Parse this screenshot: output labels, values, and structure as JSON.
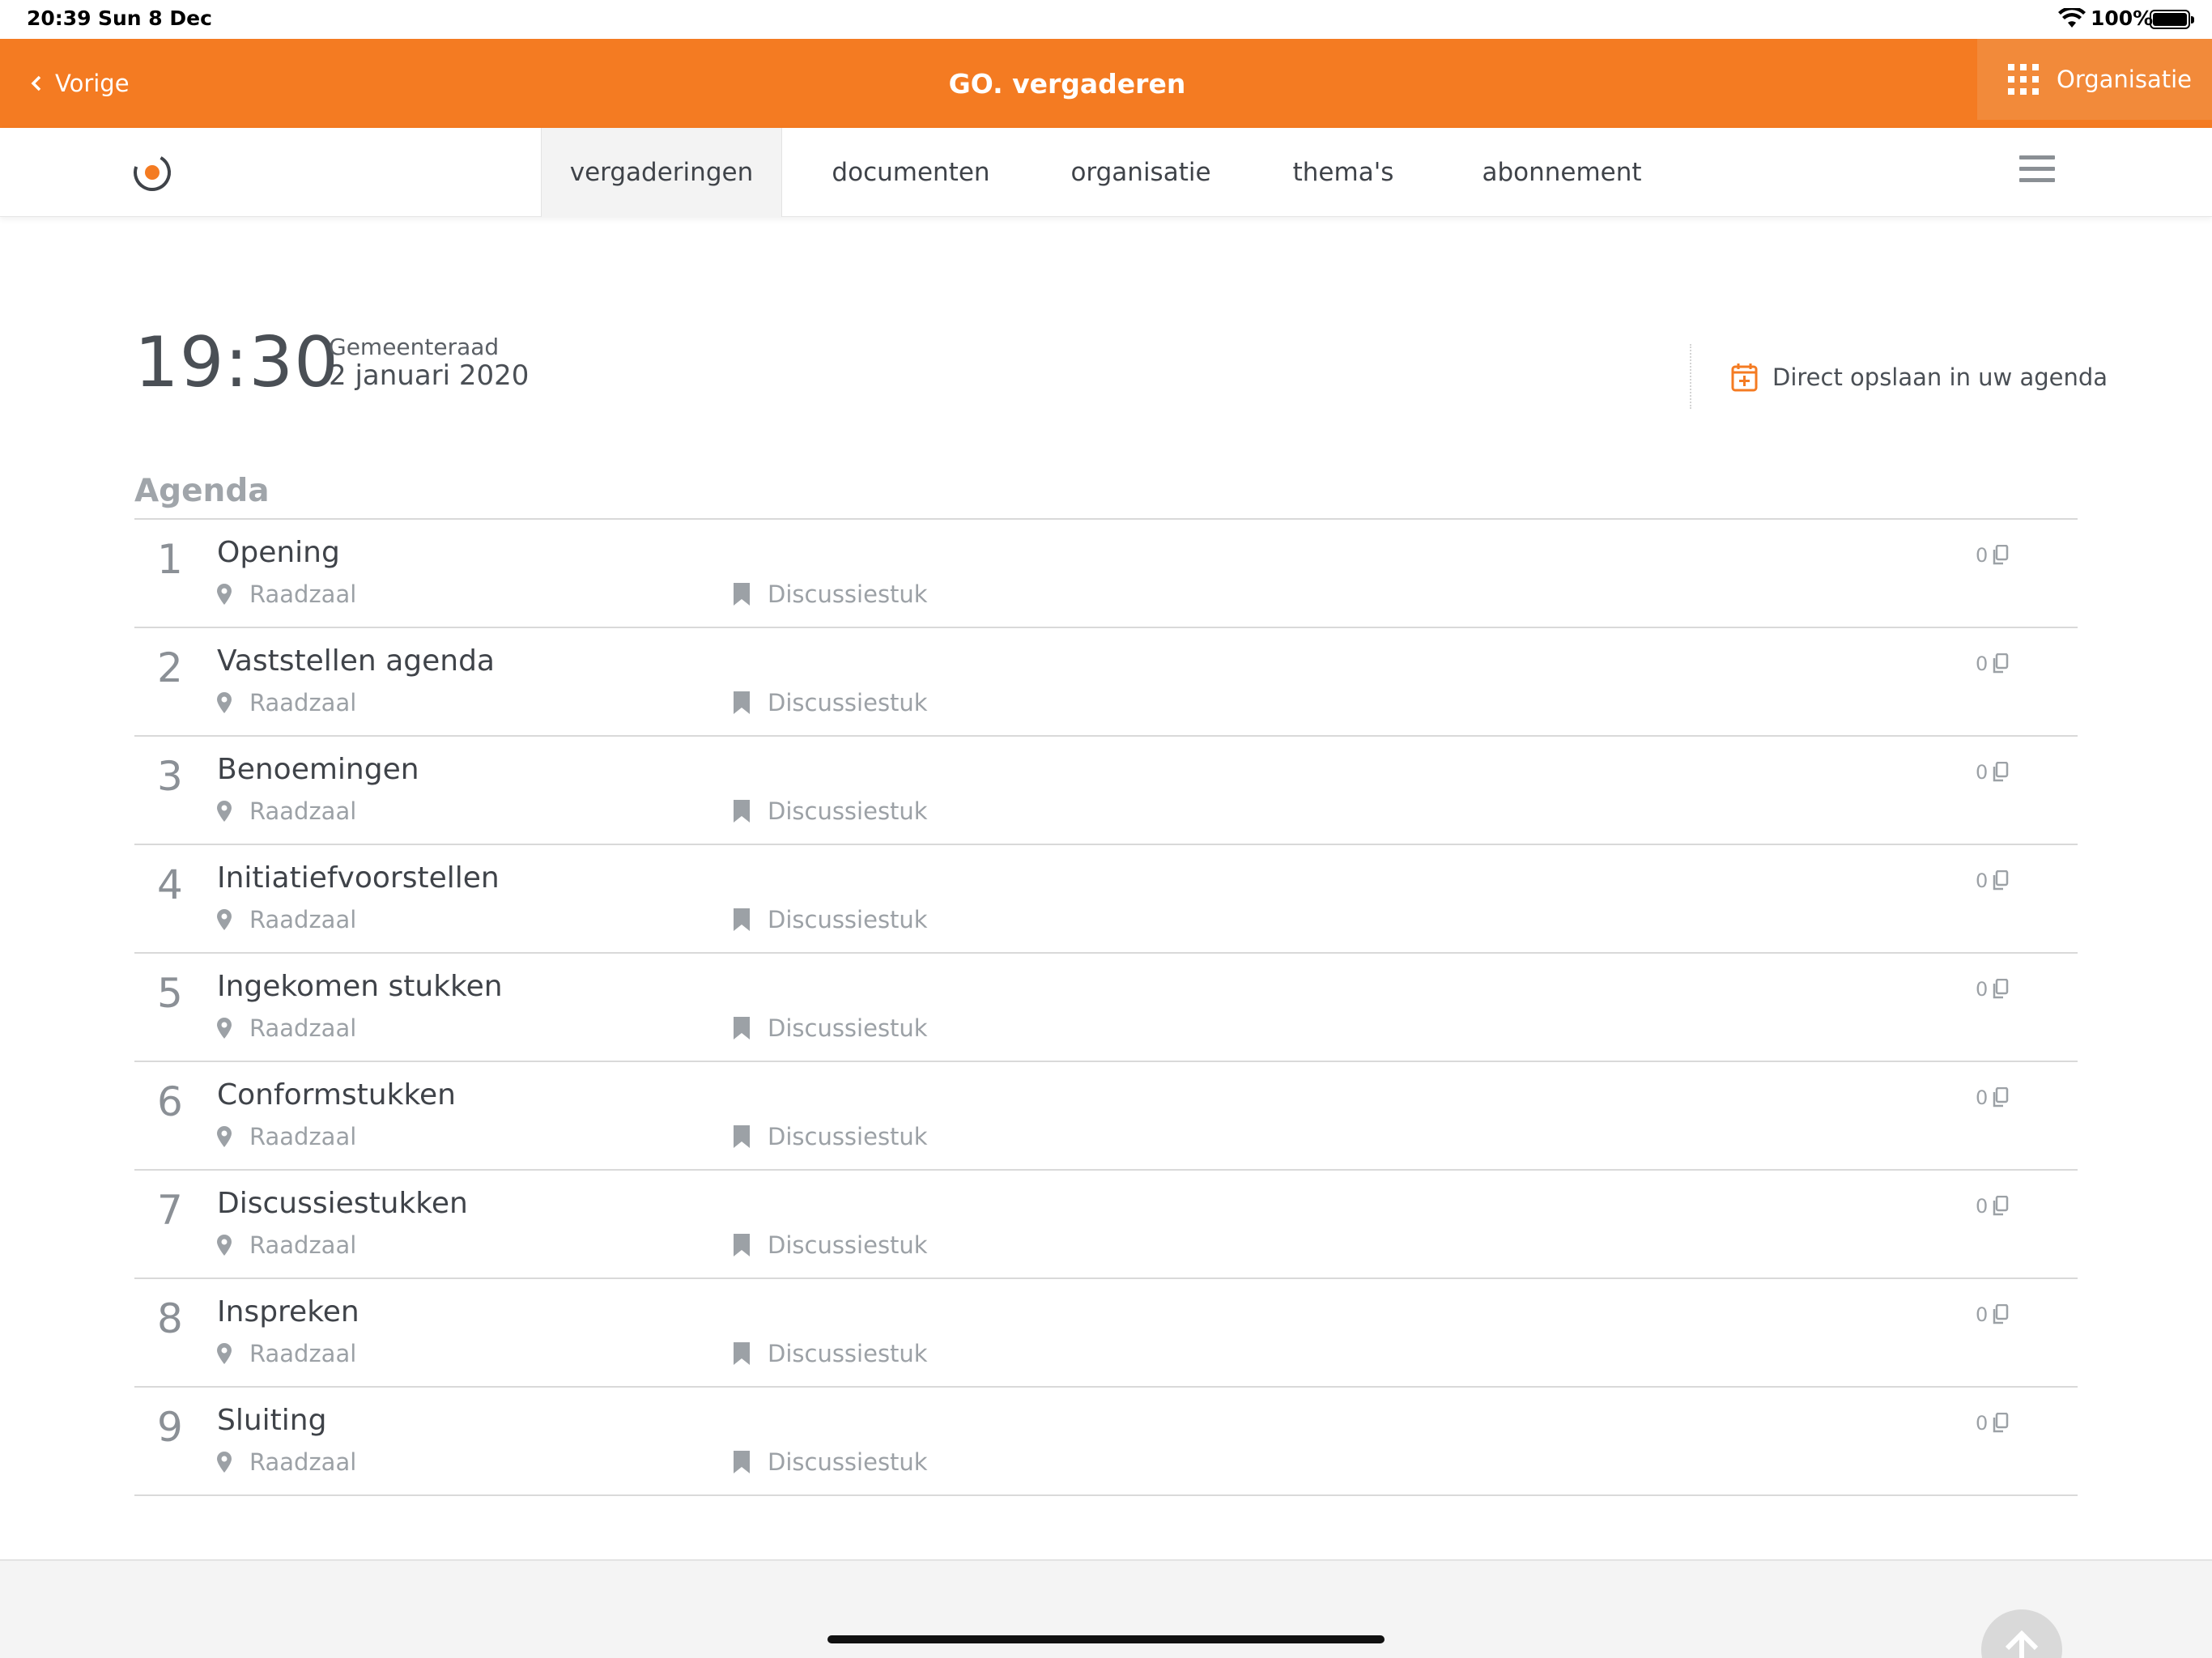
{
  "status_bar": {
    "time": "20:39",
    "date": "Sun 8 Dec",
    "battery": "100%",
    "battery_level": 1.0
  },
  "app_bar": {
    "back_label": "Vorige",
    "title": "GO. vergaderen",
    "organisation_label": "Organisatie",
    "background_color": "#f47b22"
  },
  "nav": {
    "tabs": [
      {
        "label": "vergaderingen",
        "active": true
      },
      {
        "label": "documenten",
        "active": false
      },
      {
        "label": "organisatie",
        "active": false
      },
      {
        "label": "thema's",
        "active": false
      },
      {
        "label": "abonnement",
        "active": false
      }
    ]
  },
  "meeting": {
    "time": "19:30",
    "body": "Gemeenteraad",
    "date": "2 januari 2020",
    "save_to_calendar": "Direct opslaan in uw agenda"
  },
  "agenda": {
    "heading": "Agenda",
    "items": [
      {
        "number": "1",
        "title": "Opening",
        "location": "Raadzaal",
        "type": "Discussiestuk",
        "documents": "0"
      },
      {
        "number": "2",
        "title": "Vaststellen agenda",
        "location": "Raadzaal",
        "type": "Discussiestuk",
        "documents": "0"
      },
      {
        "number": "3",
        "title": "Benoemingen",
        "location": "Raadzaal",
        "type": "Discussiestuk",
        "documents": "0"
      },
      {
        "number": "4",
        "title": "Initiatiefvoorstellen",
        "location": "Raadzaal",
        "type": "Discussiestuk",
        "documents": "0"
      },
      {
        "number": "5",
        "title": "Ingekomen stukken",
        "location": "Raadzaal",
        "type": "Discussiestuk",
        "documents": "0"
      },
      {
        "number": "6",
        "title": "Conformstukken",
        "location": "Raadzaal",
        "type": "Discussiestuk",
        "documents": "0"
      },
      {
        "number": "7",
        "title": "Discussiestukken",
        "location": "Raadzaal",
        "type": "Discussiestuk",
        "documents": "0"
      },
      {
        "number": "8",
        "title": "Inspreken",
        "location": "Raadzaal",
        "type": "Discussiestuk",
        "documents": "0"
      },
      {
        "number": "9",
        "title": "Sluiting",
        "location": "Raadzaal",
        "type": "Discussiestuk",
        "documents": "0"
      }
    ]
  },
  "icons": {
    "back": "chevron-left-icon",
    "organisation": "grid-icon",
    "menu": "hamburger-icon",
    "calendar": "calendar-plus-icon",
    "location": "map-pin-icon",
    "type": "bookmark-icon",
    "documents": "copy-icon",
    "scroll_top": "arrow-up-icon"
  }
}
